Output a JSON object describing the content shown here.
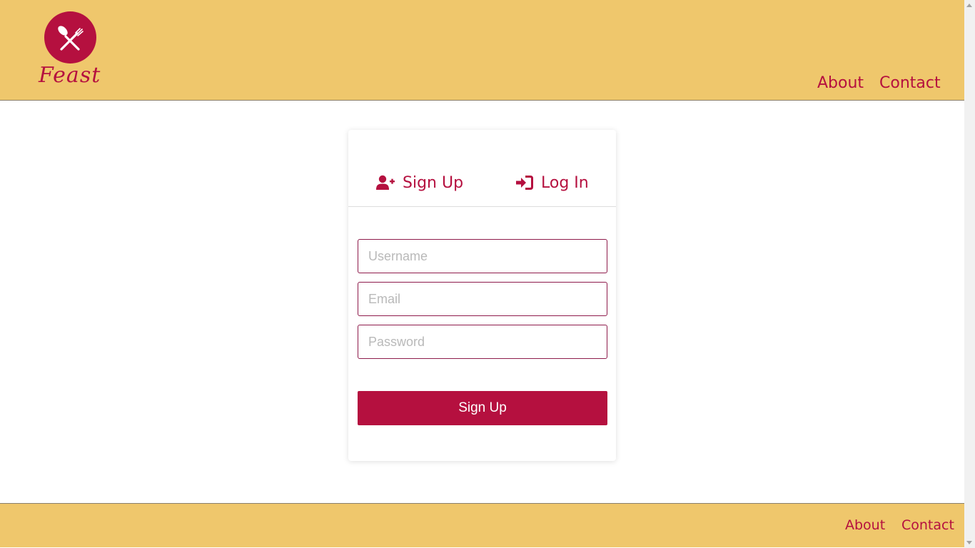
{
  "brand": {
    "name": "Feast",
    "color": "#b5103f",
    "header_bg": "#efc76c"
  },
  "header": {
    "nav": {
      "about": "About",
      "contact": "Contact"
    }
  },
  "auth_card": {
    "tabs": {
      "signup": {
        "label": "Sign Up",
        "icon": "user-plus-icon"
      },
      "login": {
        "label": "Log In",
        "icon": "sign-in-icon"
      }
    },
    "fields": {
      "username": {
        "placeholder": "Username",
        "value": ""
      },
      "email": {
        "placeholder": "Email",
        "value": ""
      },
      "password": {
        "placeholder": "Password",
        "value": ""
      }
    },
    "submit_label": "Sign Up"
  },
  "footer": {
    "nav": {
      "about": "About",
      "contact": "Contact"
    }
  }
}
